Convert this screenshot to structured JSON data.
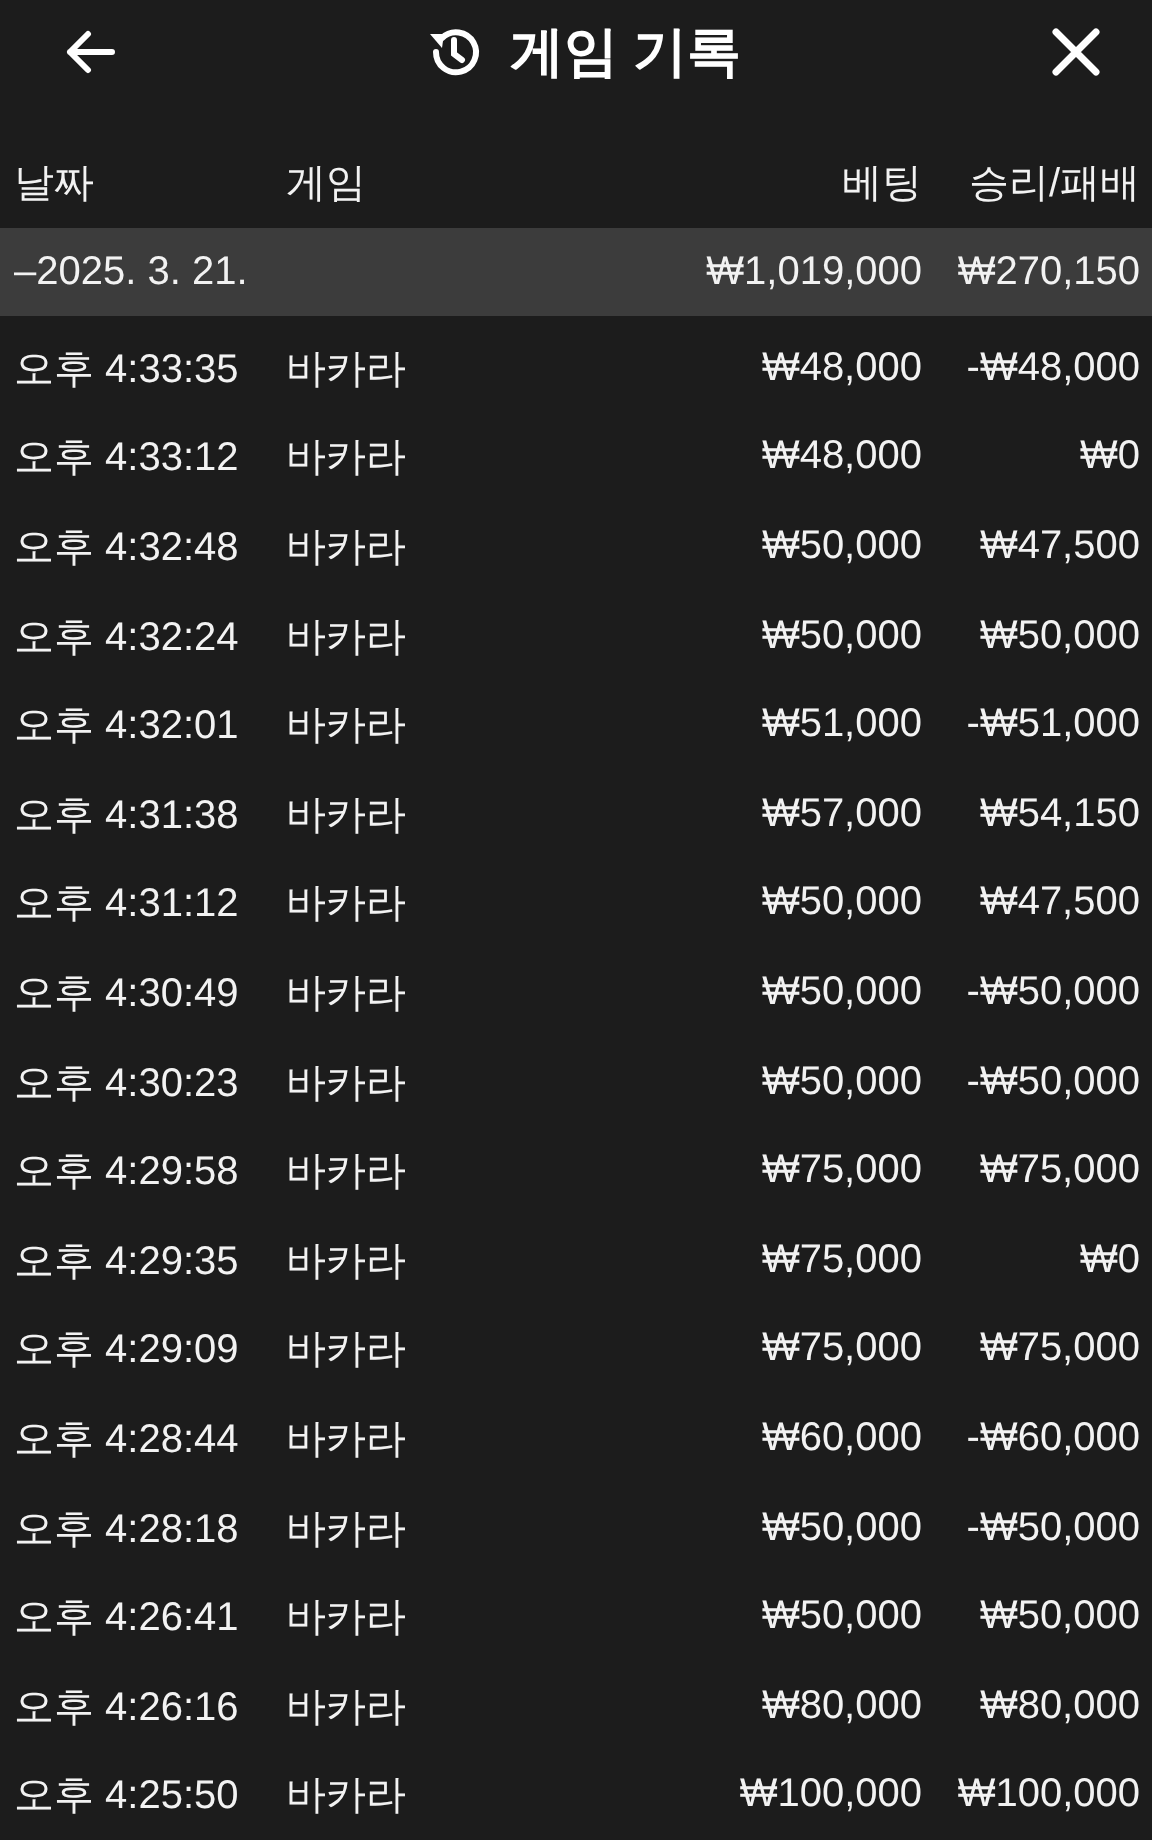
{
  "header": {
    "title": "게임 기록"
  },
  "columns": [
    "날짜",
    "게임",
    "베팅",
    "승리/패배"
  ],
  "summary": {
    "date": "–2025. 3. 21.",
    "bet": "₩1,019,000",
    "result": "₩270,150"
  },
  "rows": [
    {
      "time": "오후 4:33:35",
      "game": "바카라",
      "bet": "₩48,000",
      "result": "-₩48,000"
    },
    {
      "time": "오후 4:33:12",
      "game": "바카라",
      "bet": "₩48,000",
      "result": "₩0"
    },
    {
      "time": "오후 4:32:48",
      "game": "바카라",
      "bet": "₩50,000",
      "result": "₩47,500"
    },
    {
      "time": "오후 4:32:24",
      "game": "바카라",
      "bet": "₩50,000",
      "result": "₩50,000"
    },
    {
      "time": "오후 4:32:01",
      "game": "바카라",
      "bet": "₩51,000",
      "result": "-₩51,000"
    },
    {
      "time": "오후 4:31:38",
      "game": "바카라",
      "bet": "₩57,000",
      "result": "₩54,150"
    },
    {
      "time": "오후 4:31:12",
      "game": "바카라",
      "bet": "₩50,000",
      "result": "₩47,500"
    },
    {
      "time": "오후 4:30:49",
      "game": "바카라",
      "bet": "₩50,000",
      "result": "-₩50,000"
    },
    {
      "time": "오후 4:30:23",
      "game": "바카라",
      "bet": "₩50,000",
      "result": "-₩50,000"
    },
    {
      "time": "오후 4:29:58",
      "game": "바카라",
      "bet": "₩75,000",
      "result": "₩75,000"
    },
    {
      "time": "오후 4:29:35",
      "game": "바카라",
      "bet": "₩75,000",
      "result": "₩0"
    },
    {
      "time": "오후 4:29:09",
      "game": "바카라",
      "bet": "₩75,000",
      "result": "₩75,000"
    },
    {
      "time": "오후 4:28:44",
      "game": "바카라",
      "bet": "₩60,000",
      "result": "-₩60,000"
    },
    {
      "time": "오후 4:28:18",
      "game": "바카라",
      "bet": "₩50,000",
      "result": "-₩50,000"
    },
    {
      "time": "오후 4:26:41",
      "game": "바카라",
      "bet": "₩50,000",
      "result": "₩50,000"
    },
    {
      "time": "오후 4:26:16",
      "game": "바카라",
      "bet": "₩80,000",
      "result": "₩80,000"
    },
    {
      "time": "오후 4:25:50",
      "game": "바카라",
      "bet": "₩100,000",
      "result": "₩100,000"
    }
  ]
}
